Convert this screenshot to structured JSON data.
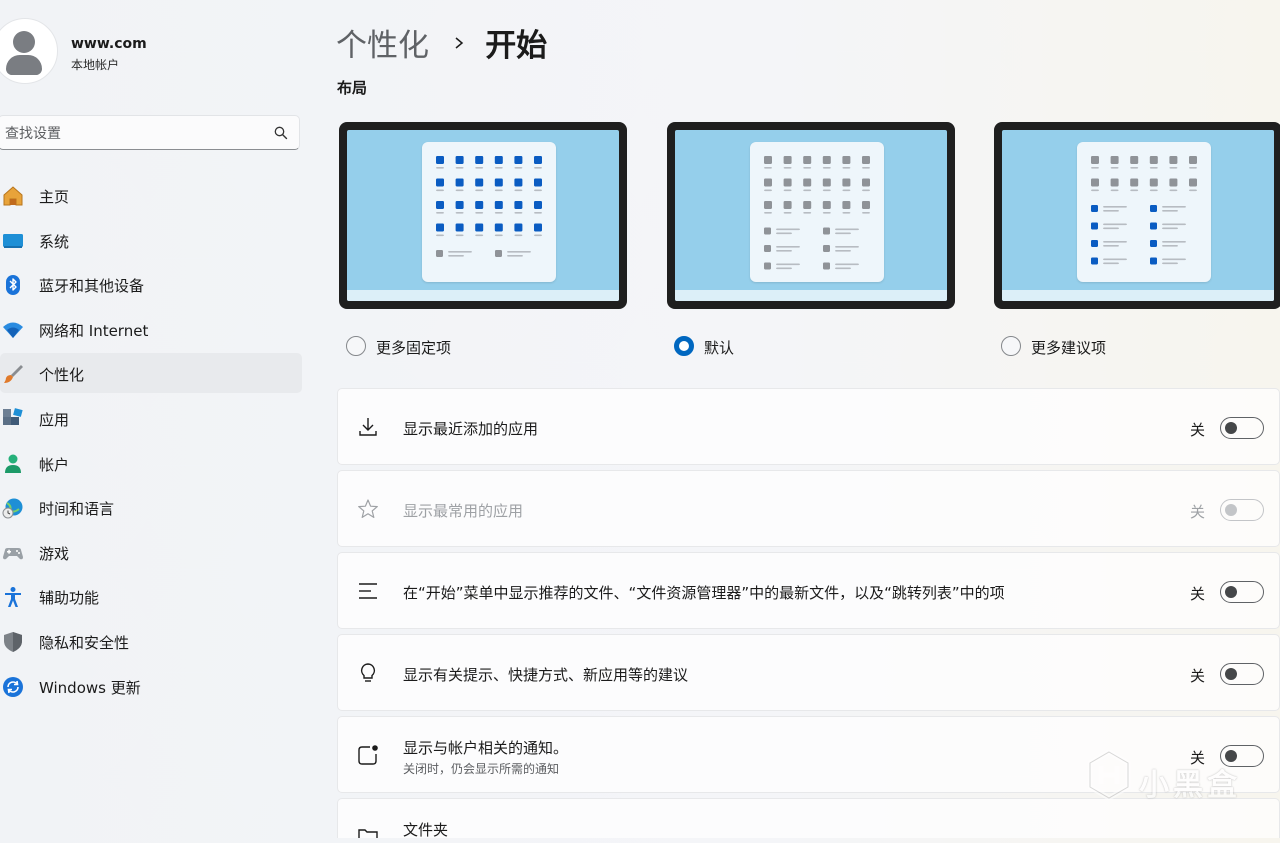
{
  "profile": {
    "name": "www.com",
    "account_type": "本地帐户"
  },
  "search": {
    "placeholder": "查找设置"
  },
  "sidebar": {
    "items": [
      {
        "label": "主页",
        "icon": "home-icon",
        "active": false
      },
      {
        "label": "系统",
        "icon": "monitor-icon",
        "active": false
      },
      {
        "label": "蓝牙和其他设备",
        "icon": "bluetooth-icon",
        "active": false
      },
      {
        "label": "网络和 Internet",
        "icon": "wifi-icon",
        "active": false
      },
      {
        "label": "个性化",
        "icon": "brush-icon",
        "active": true
      },
      {
        "label": "应用",
        "icon": "apps-icon",
        "active": false
      },
      {
        "label": "帐户",
        "icon": "person-icon",
        "active": false
      },
      {
        "label": "时间和语言",
        "icon": "globe-clock-icon",
        "active": false
      },
      {
        "label": "游戏",
        "icon": "gamepad-icon",
        "active": false
      },
      {
        "label": "辅助功能",
        "icon": "accessibility-icon",
        "active": false
      },
      {
        "label": "隐私和安全性",
        "icon": "shield-icon",
        "active": false
      },
      {
        "label": "Windows 更新",
        "icon": "update-icon",
        "active": false
      }
    ]
  },
  "breadcrumb": {
    "parent": "个性化",
    "current": "开始"
  },
  "layout_section": {
    "label": "布局",
    "options": [
      {
        "label": "更多固定项",
        "selected": false,
        "style": "more-pins"
      },
      {
        "label": "默认",
        "selected": true,
        "style": "default"
      },
      {
        "label": "更多建议项",
        "selected": false,
        "style": "more-recommendations"
      }
    ]
  },
  "settings": [
    {
      "title": "显示最近添加的应用",
      "subtitle": "",
      "state": "关",
      "on": false,
      "enabled": true,
      "icon": "download-icon"
    },
    {
      "title": "显示最常用的应用",
      "subtitle": "",
      "state": "关",
      "on": false,
      "enabled": false,
      "icon": "star-icon"
    },
    {
      "title": "在“开始”菜单中显示推荐的文件、“文件资源管理器”中的最新文件，以及“跳转列表”中的项",
      "subtitle": "",
      "state": "关",
      "on": false,
      "enabled": true,
      "icon": "list-icon"
    },
    {
      "title": "显示有关提示、快捷方式、新应用等的建议",
      "subtitle": "",
      "state": "关",
      "on": false,
      "enabled": true,
      "icon": "lightbulb-icon"
    },
    {
      "title": "显示与帐户相关的通知。",
      "subtitle": "关闭时，仍会显示所需的通知",
      "state": "关",
      "on": false,
      "enabled": true,
      "icon": "notification-icon"
    },
    {
      "title": "文件夹",
      "subtitle": "",
      "state": "",
      "on": false,
      "enabled": true,
      "icon": "folder-icon",
      "partial": true
    }
  ],
  "watermark": {
    "text": "小黑盒"
  },
  "colors": {
    "accent": "#0067c0",
    "tile_blue": "#0a5cc2",
    "tile_gray": "#8f9398",
    "screen_bg": "#95cfeb"
  }
}
